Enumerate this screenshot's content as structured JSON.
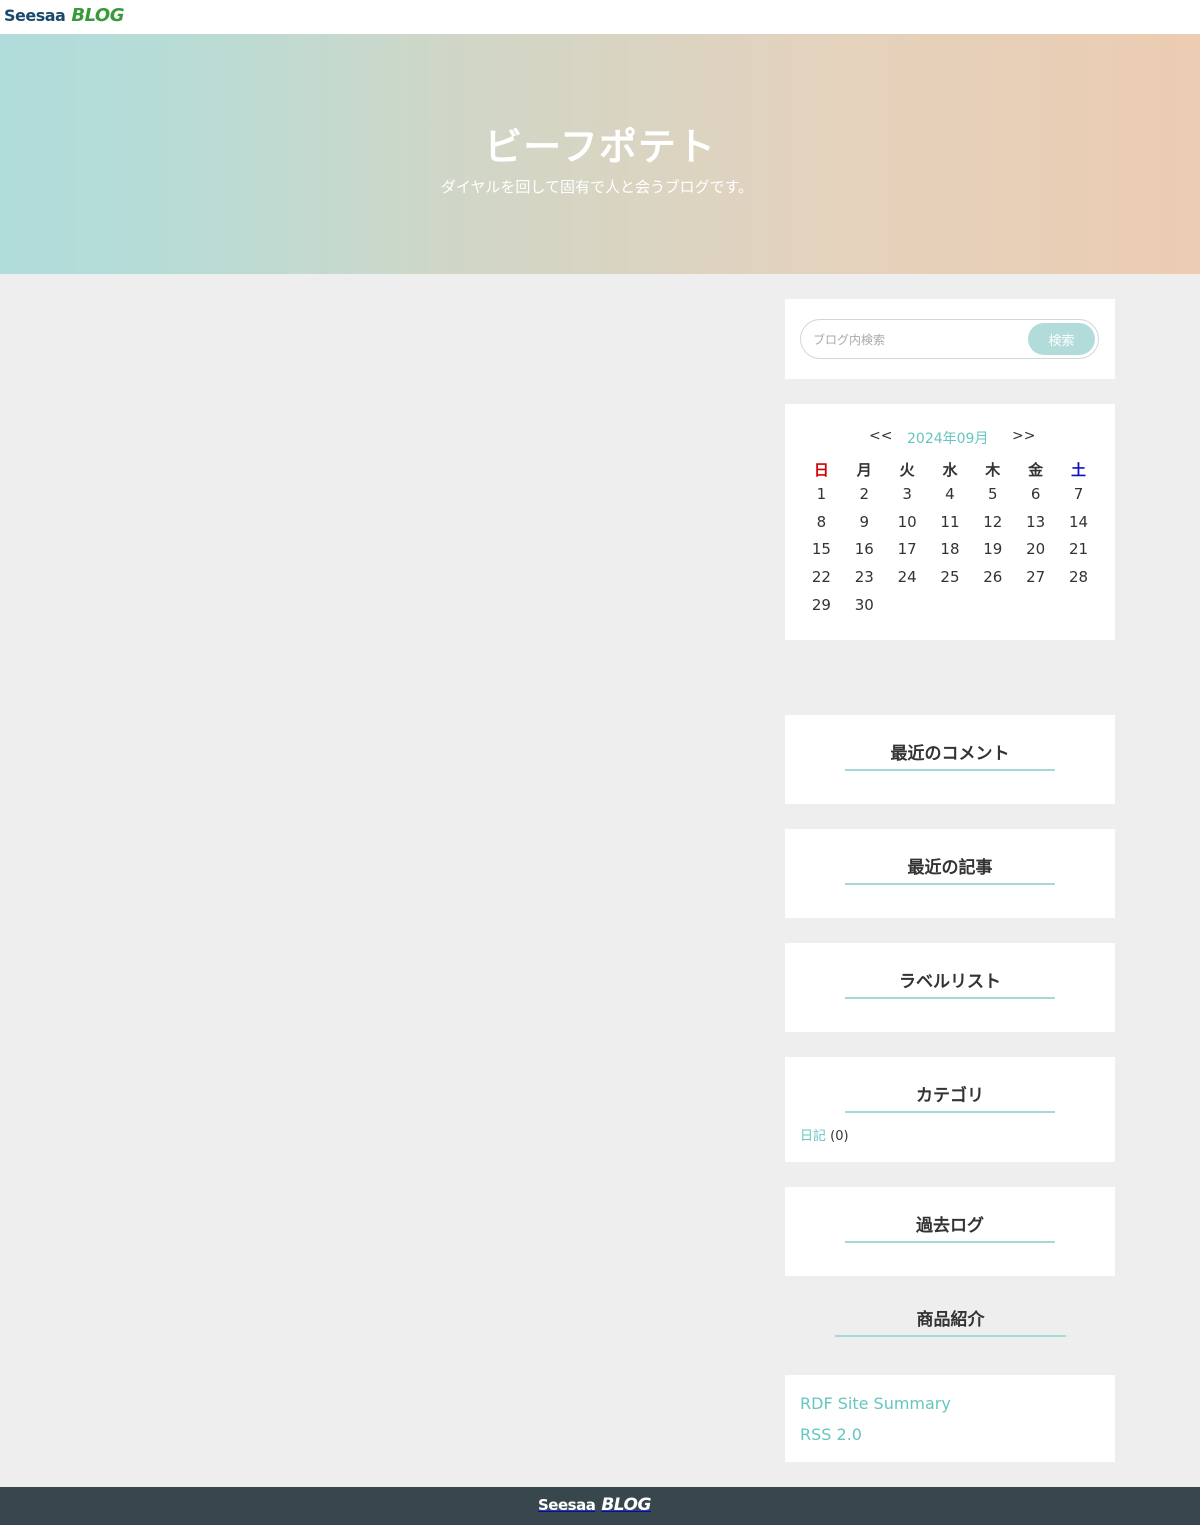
{
  "topbar": {
    "logo_main": "Seesaa",
    "logo_sub": "BLOG"
  },
  "header": {
    "title": "ビーフポテト",
    "subtitle": "ダイヤルを回して固有で人と会うブログです。"
  },
  "search": {
    "placeholder": "ブログ内検索",
    "button_label": "検索"
  },
  "calendar": {
    "prev_label": "<<",
    "month_label": "2024年09月",
    "next_label": ">>",
    "weekdays": [
      "日",
      "月",
      "火",
      "水",
      "木",
      "金",
      "土"
    ],
    "weeks": [
      [
        "1",
        "2",
        "3",
        "4",
        "5",
        "6",
        "7"
      ],
      [
        "8",
        "9",
        "10",
        "11",
        "12",
        "13",
        "14"
      ],
      [
        "15",
        "16",
        "17",
        "18",
        "19",
        "20",
        "21"
      ],
      [
        "22",
        "23",
        "24",
        "25",
        "26",
        "27",
        "28"
      ],
      [
        "29",
        "30",
        "",
        "",
        "",
        "",
        ""
      ]
    ]
  },
  "widgets": {
    "recent_comments": "最近のコメント",
    "recent_articles": "最近の記事",
    "label_list": "ラベルリスト",
    "category": {
      "title": "カテゴリ",
      "items": [
        {
          "name": "日記",
          "count": "(0)"
        }
      ]
    },
    "archive": "過去ログ",
    "products": "商品紹介"
  },
  "feeds": {
    "rdf": "RDF Site Summary",
    "rss": "RSS 2.0"
  },
  "footer": {
    "logo_main": "Seesaa",
    "logo_sub": "BLOG"
  },
  "colors": {
    "accent": "#66c6c0",
    "underline": "#a6d9d6",
    "footer_bg": "#37474d",
    "sunday": "#d40000",
    "saturday": "#1010c0"
  }
}
